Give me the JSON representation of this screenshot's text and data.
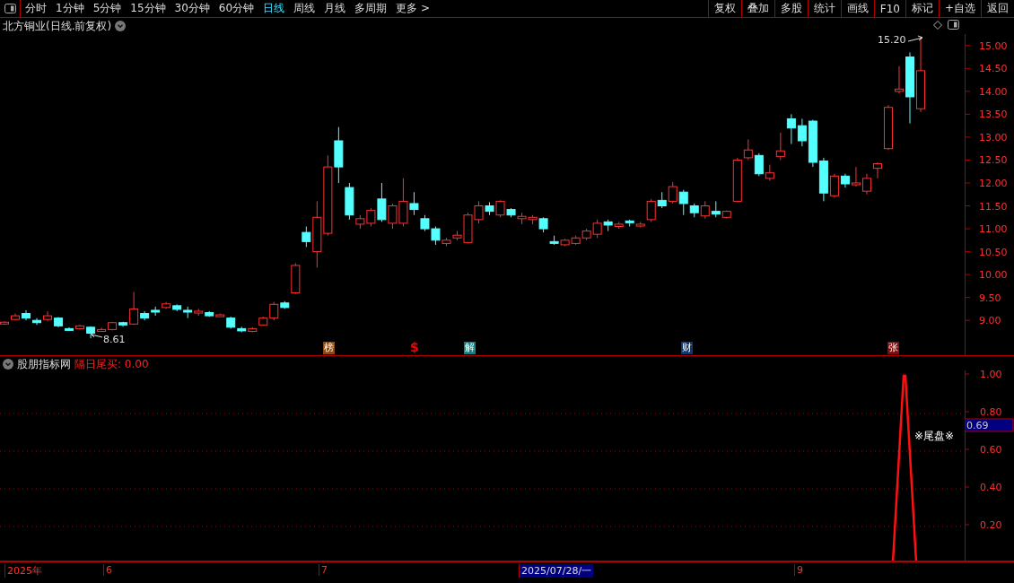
{
  "toolbar": {
    "periods": [
      {
        "label": "分时",
        "selected": false
      },
      {
        "label": "1分钟",
        "selected": false
      },
      {
        "label": "5分钟",
        "selected": false
      },
      {
        "label": "15分钟",
        "selected": false
      },
      {
        "label": "30分钟",
        "selected": false
      },
      {
        "label": "60分钟",
        "selected": false
      },
      {
        "label": "日线",
        "selected": true
      },
      {
        "label": "周线",
        "selected": false
      },
      {
        "label": "月线",
        "selected": false
      },
      {
        "label": "多周期",
        "selected": false
      },
      {
        "label": "更多 >",
        "selected": false
      }
    ],
    "buttons": [
      "复权",
      "叠加",
      "多股",
      "统计",
      "画线",
      "F10",
      "标记",
      "+自选",
      "返回"
    ]
  },
  "main_chart": {
    "title": "北方铜业(日线.前复权)",
    "high_label": "15.20",
    "low_label": "8.61",
    "chart_data": {
      "type": "candlestick",
      "ohlc": [
        [
          8.93,
          8.98,
          8.9,
          8.96
        ],
        [
          9.02,
          9.15,
          9.0,
          9.1
        ],
        [
          9.15,
          9.22,
          9.0,
          9.05
        ],
        [
          9.0,
          9.05,
          8.9,
          8.95
        ],
        [
          9.02,
          9.2,
          8.98,
          9.1
        ],
        [
          9.05,
          9.07,
          8.85,
          8.88
        ],
        [
          8.82,
          8.85,
          8.78,
          8.8
        ],
        [
          8.82,
          8.9,
          8.8,
          8.88
        ],
        [
          8.85,
          8.87,
          8.61,
          8.72
        ],
        [
          8.78,
          8.84,
          8.76,
          8.8
        ],
        [
          8.8,
          8.97,
          8.78,
          8.95
        ],
        [
          8.95,
          8.97,
          8.86,
          8.9
        ],
        [
          8.92,
          9.62,
          8.9,
          9.25
        ],
        [
          9.15,
          9.2,
          9.0,
          9.05
        ],
        [
          9.22,
          9.3,
          9.1,
          9.18
        ],
        [
          9.28,
          9.4,
          9.25,
          9.36
        ],
        [
          9.32,
          9.35,
          9.2,
          9.24
        ],
        [
          9.22,
          9.3,
          9.05,
          9.18
        ],
        [
          9.16,
          9.25,
          9.1,
          9.2
        ],
        [
          9.17,
          9.2,
          9.08,
          9.1
        ],
        [
          9.1,
          9.15,
          9.08,
          9.12
        ],
        [
          9.05,
          9.08,
          8.82,
          8.85
        ],
        [
          8.82,
          8.86,
          8.74,
          8.77
        ],
        [
          8.76,
          8.85,
          8.74,
          8.82
        ],
        [
          8.9,
          9.08,
          8.88,
          9.05
        ],
        [
          9.05,
          9.4,
          9.0,
          9.35
        ],
        [
          9.38,
          9.42,
          9.25,
          9.28
        ],
        [
          9.6,
          10.25,
          9.58,
          10.2
        ],
        [
          10.92,
          11.05,
          10.6,
          10.72
        ],
        [
          10.5,
          11.6,
          10.15,
          11.25
        ],
        [
          10.9,
          12.6,
          10.85,
          12.35
        ],
        [
          12.92,
          13.22,
          12.0,
          12.35
        ],
        [
          11.9,
          12.0,
          11.2,
          11.3
        ],
        [
          11.1,
          11.3,
          11.0,
          11.22
        ],
        [
          11.12,
          11.45,
          11.05,
          11.4
        ],
        [
          11.65,
          12.0,
          11.15,
          11.2
        ],
        [
          11.12,
          11.55,
          11.0,
          11.5
        ],
        [
          11.12,
          12.1,
          11.05,
          11.6
        ],
        [
          11.55,
          11.8,
          11.3,
          11.42
        ],
        [
          11.22,
          11.3,
          10.95,
          11.0
        ],
        [
          11.0,
          11.05,
          10.65,
          10.75
        ],
        [
          10.68,
          10.8,
          10.62,
          10.75
        ],
        [
          10.8,
          10.95,
          10.75,
          10.86
        ],
        [
          10.7,
          11.35,
          10.68,
          11.3
        ],
        [
          11.2,
          11.6,
          11.12,
          11.5
        ],
        [
          11.5,
          11.58,
          11.3,
          11.38
        ],
        [
          11.3,
          11.62,
          11.25,
          11.6
        ],
        [
          11.42,
          11.45,
          11.25,
          11.3
        ],
        [
          11.22,
          11.35,
          11.1,
          11.27
        ],
        [
          11.2,
          11.3,
          11.1,
          11.25
        ],
        [
          11.22,
          11.25,
          10.92,
          11.0
        ],
        [
          10.72,
          10.85,
          10.65,
          10.7
        ],
        [
          10.65,
          10.78,
          10.62,
          10.75
        ],
        [
          10.68,
          10.85,
          10.65,
          10.8
        ],
        [
          10.8,
          11.0,
          10.75,
          10.95
        ],
        [
          10.88,
          11.2,
          10.8,
          11.12
        ],
        [
          11.15,
          11.2,
          10.95,
          11.08
        ],
        [
          11.05,
          11.15,
          11.0,
          11.1
        ],
        [
          11.17,
          11.2,
          11.05,
          11.14
        ],
        [
          11.06,
          11.15,
          11.03,
          11.1
        ],
        [
          11.2,
          11.65,
          11.15,
          11.6
        ],
        [
          11.62,
          11.8,
          11.45,
          11.5
        ],
        [
          11.6,
          12.02,
          11.55,
          11.92
        ],
        [
          11.8,
          11.85,
          11.3,
          11.55
        ],
        [
          11.5,
          11.55,
          11.25,
          11.35
        ],
        [
          11.28,
          11.6,
          11.22,
          11.5
        ],
        [
          11.38,
          11.6,
          11.25,
          11.32
        ],
        [
          11.25,
          11.4,
          11.22,
          11.38
        ],
        [
          11.6,
          12.55,
          11.58,
          12.5
        ],
        [
          12.55,
          12.95,
          12.5,
          12.72
        ],
        [
          12.6,
          12.65,
          12.15,
          12.2
        ],
        [
          12.1,
          12.4,
          12.05,
          12.22
        ],
        [
          12.58,
          13.1,
          12.5,
          12.7
        ],
        [
          13.4,
          13.5,
          12.85,
          13.2
        ],
        [
          13.25,
          13.4,
          12.8,
          12.92
        ],
        [
          13.35,
          13.38,
          12.35,
          12.45
        ],
        [
          12.48,
          12.55,
          11.6,
          11.78
        ],
        [
          11.72,
          12.2,
          11.68,
          12.15
        ],
        [
          12.15,
          12.2,
          11.9,
          11.98
        ],
        [
          11.96,
          12.35,
          11.92,
          12.0
        ],
        [
          11.82,
          12.2,
          11.75,
          12.1
        ],
        [
          12.32,
          12.45,
          12.1,
          12.42
        ],
        [
          12.75,
          13.7,
          12.72,
          13.65
        ],
        [
          14.0,
          14.55,
          13.95,
          14.05
        ],
        [
          14.75,
          14.85,
          13.3,
          13.88
        ],
        [
          13.62,
          15.2,
          13.55,
          14.45
        ]
      ],
      "ylim": [
        8.24,
        15.25
      ],
      "yticks": [
        {
          "value": 15.0,
          "label": "15.00"
        },
        {
          "value": 14.5,
          "label": "14.50"
        },
        {
          "value": 14.0,
          "label": "14.00"
        },
        {
          "value": 13.5,
          "label": "13.50"
        },
        {
          "value": 13.0,
          "label": "13.00"
        },
        {
          "value": 12.5,
          "label": "12.50"
        },
        {
          "value": 12.0,
          "label": "12.00"
        },
        {
          "value": 11.5,
          "label": "11.50"
        },
        {
          "value": 11.0,
          "label": "11.00"
        },
        {
          "value": 10.5,
          "label": "10.50"
        },
        {
          "value": 10.0,
          "label": "10.00"
        },
        {
          "value": 9.5,
          "label": "9.50"
        },
        {
          "value": 9.0,
          "label": "9.00"
        }
      ]
    },
    "event_markers": [
      {
        "label": "榜",
        "kind": "badge",
        "color": "#8b4a10"
      },
      {
        "label": "$",
        "kind": "text",
        "color": "#ff0000"
      },
      {
        "label": "解",
        "kind": "badge",
        "color": "#138080"
      },
      {
        "label": "财",
        "kind": "badge",
        "color": "#0c3a6e"
      },
      {
        "label": "张",
        "kind": "badge",
        "color": "#7a0d0d"
      }
    ]
  },
  "indicator": {
    "name": "股朋指标网",
    "value_label": "隔日尾买: 0.00",
    "annotation": "※尾盘※",
    "axis": [
      "1.00",
      "0.80",
      "0.60",
      "0.40",
      "0.20"
    ],
    "cursor_value": "0.69"
  },
  "date_axis": [
    {
      "label": "2025年",
      "selected": false
    },
    {
      "label": "6",
      "selected": false
    },
    {
      "label": "7",
      "selected": false
    },
    {
      "label": "2025/07/28/一",
      "selected": true
    },
    {
      "label": "9",
      "selected": false
    }
  ]
}
